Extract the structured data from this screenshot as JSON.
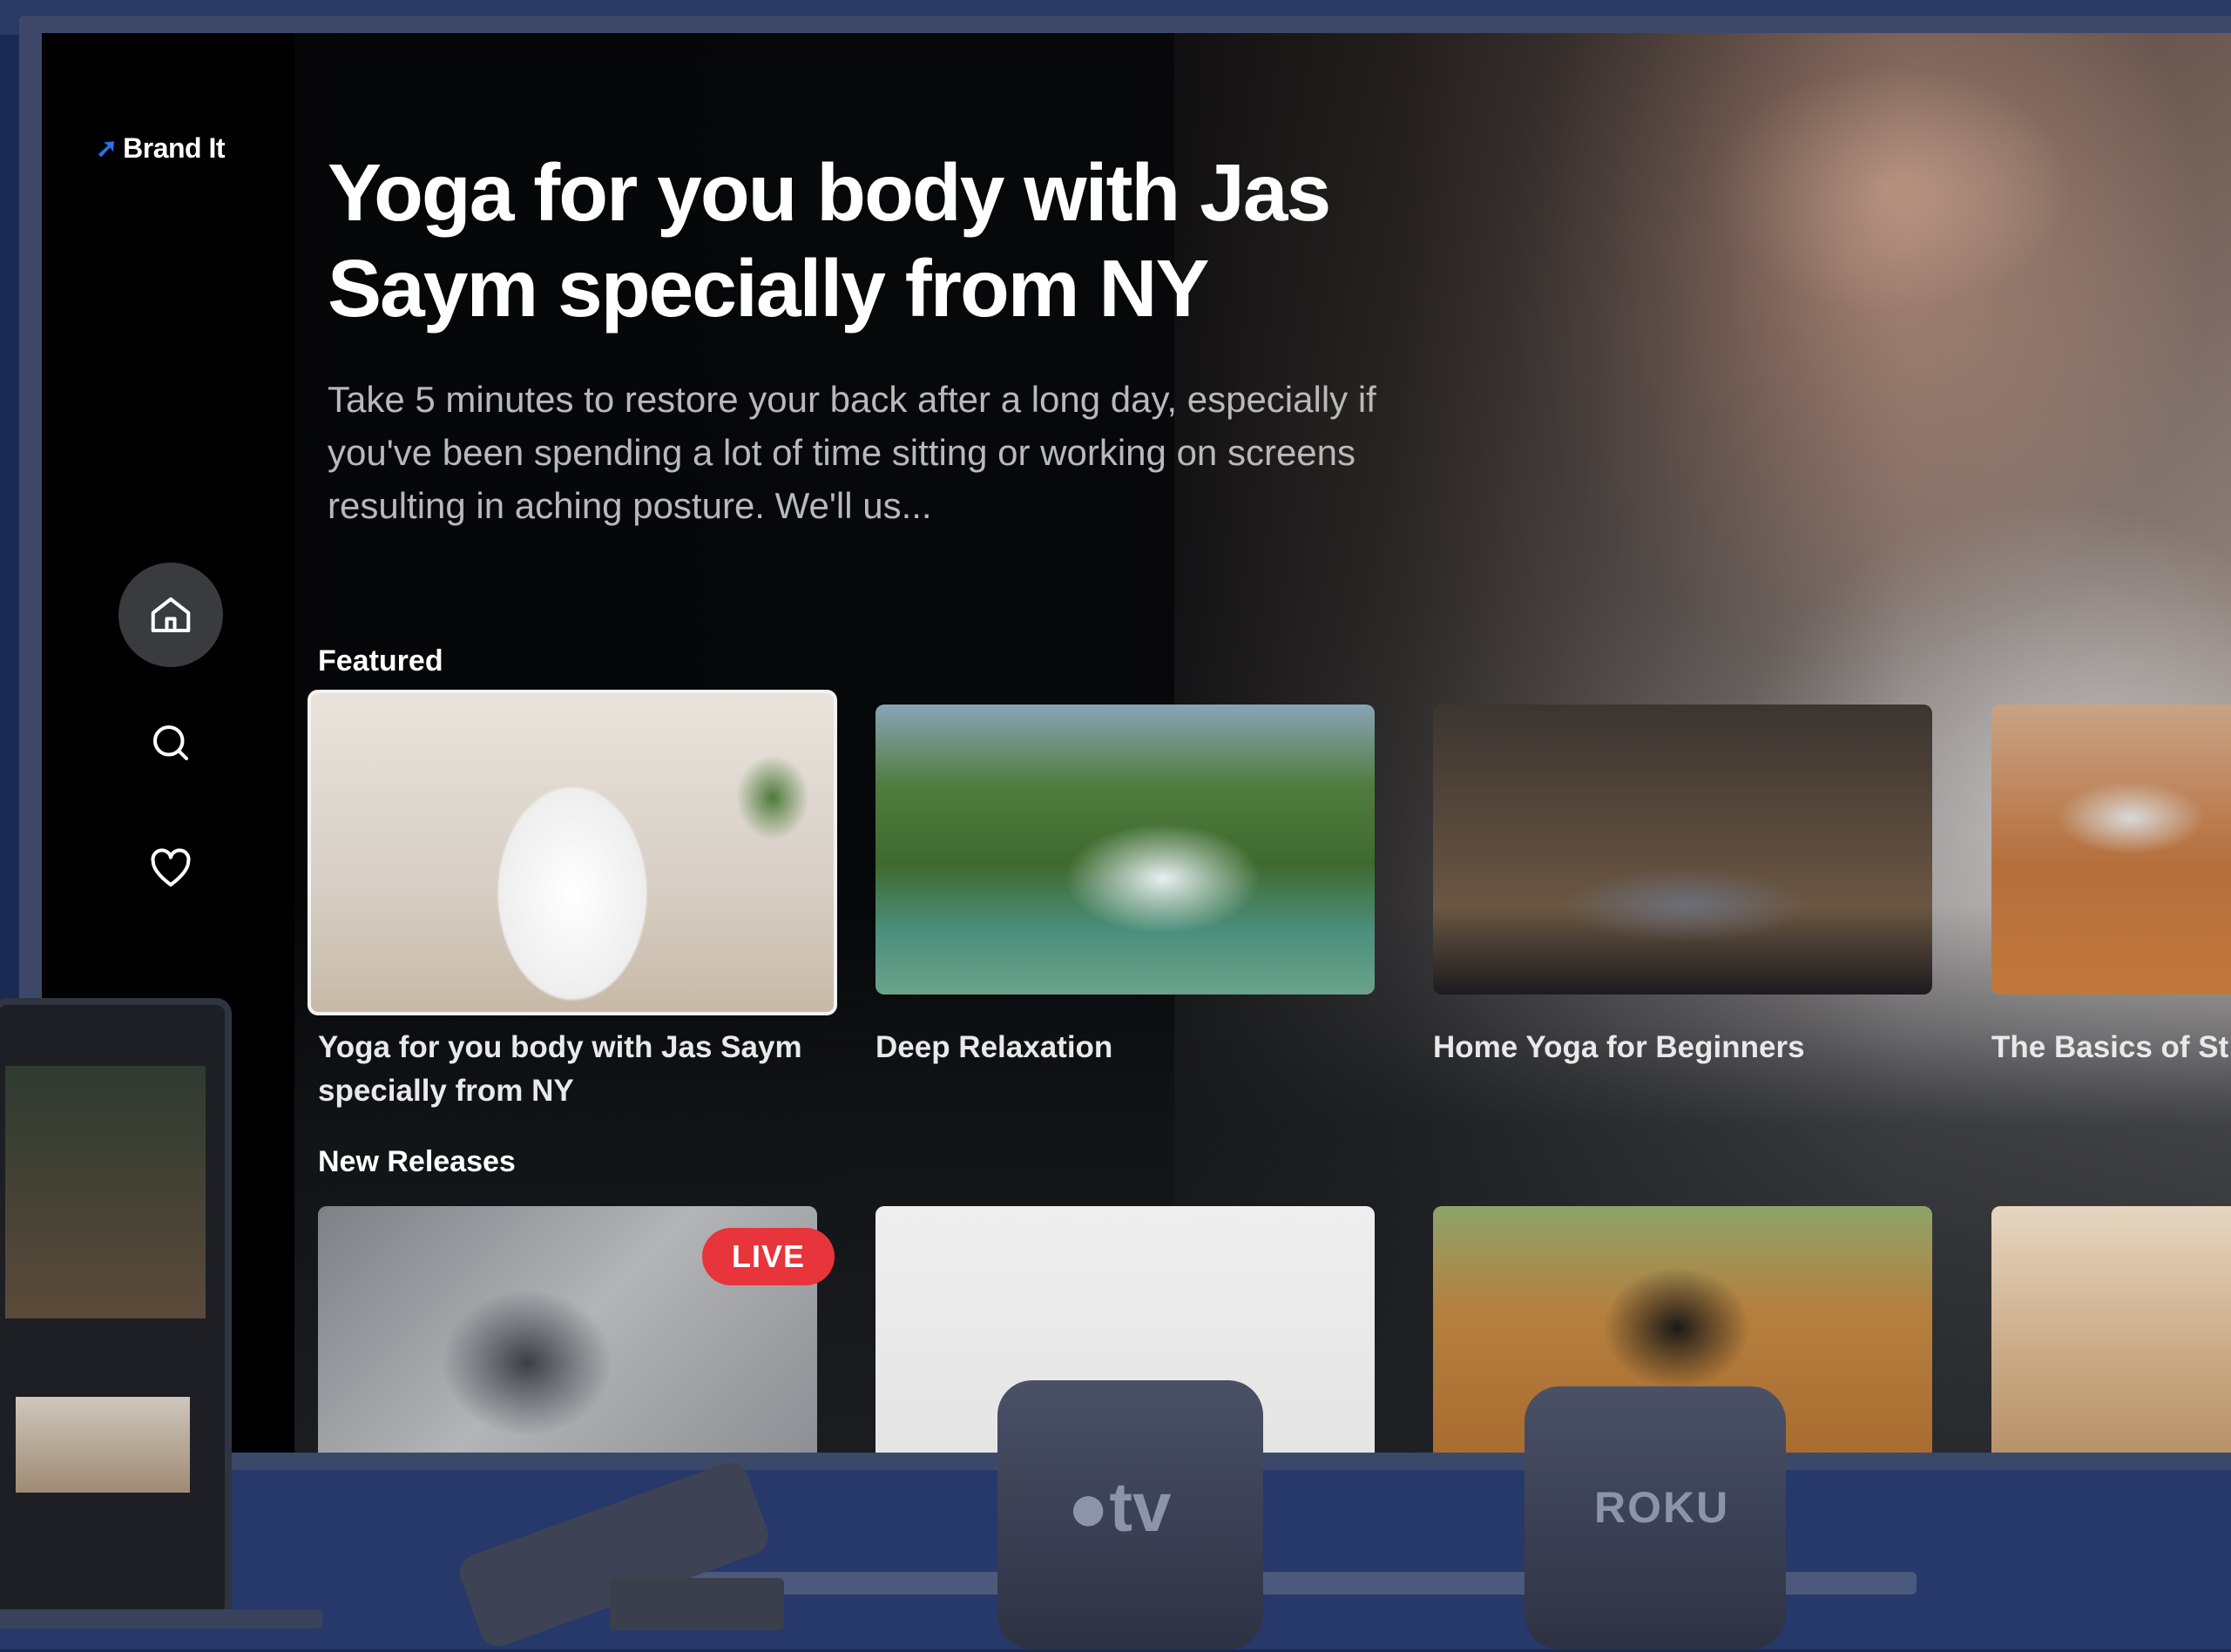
{
  "brand": {
    "name": "Brand It"
  },
  "sidebar": {
    "items": [
      {
        "icon": "home-icon",
        "active": true
      },
      {
        "icon": "search-icon",
        "active": false
      },
      {
        "icon": "heart-icon",
        "active": false
      }
    ]
  },
  "hero": {
    "title": "Yoga for you body with Jas Saym specially from NY",
    "description": "Take 5 minutes to restore your back after a long day, especially if you've been spending a lot of time sitting or working on screens resulting in aching posture. We'll us..."
  },
  "featured": {
    "label": "Featured",
    "cards": [
      {
        "title": "Yoga for you body with Jas Saym specially from NY"
      },
      {
        "title": "Deep Relaxation"
      },
      {
        "title": "Home Yoga for Beginners"
      },
      {
        "title": "The Basics of St"
      }
    ]
  },
  "new_releases": {
    "label": "New Releases",
    "live_badge": "LIVE"
  },
  "devices": {
    "apple_tv_label": "tv",
    "roku_label": "ROKU"
  },
  "colors": {
    "accent": "#2f6fe8",
    "live": "#e8343b",
    "background": "#050608",
    "frame": "#27386a"
  }
}
